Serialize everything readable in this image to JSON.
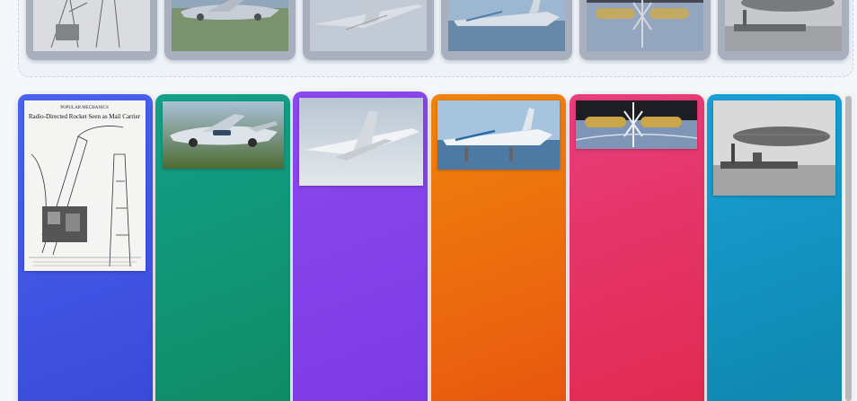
{
  "thumbnail_strip": [
    {
      "icon": "rocket-article-image"
    },
    {
      "icon": "flying-car-image"
    },
    {
      "icon": "concorde-image"
    },
    {
      "icon": "ekranoplan-image"
    },
    {
      "icon": "space-station-image"
    },
    {
      "icon": "zeppelin-image"
    }
  ],
  "columns": [
    {
      "color_top": "#4a63f0",
      "color_bottom": "#3a48d8",
      "image": "rocket-article-image",
      "article_header": "POPULAR MECHANICS",
      "article_headline": "Radio-Directed Rocket Seen as Mail Carrier"
    },
    {
      "color_top": "#13a08a",
      "color_bottom": "#0f8b63",
      "image": "flying-car-image"
    },
    {
      "color_top": "#8b48ee",
      "color_bottom": "#7c3ae3",
      "image": "concorde-image"
    },
    {
      "color_top": "#f0840e",
      "color_bottom": "#e8560f",
      "image": "ekranoplan-image"
    },
    {
      "color_top": "#e83e7c",
      "color_bottom": "#e0294f",
      "image": "space-station-image"
    },
    {
      "color_top": "#18a0d6",
      "color_bottom": "#0f86ad",
      "image": "zeppelin-image"
    }
  ]
}
